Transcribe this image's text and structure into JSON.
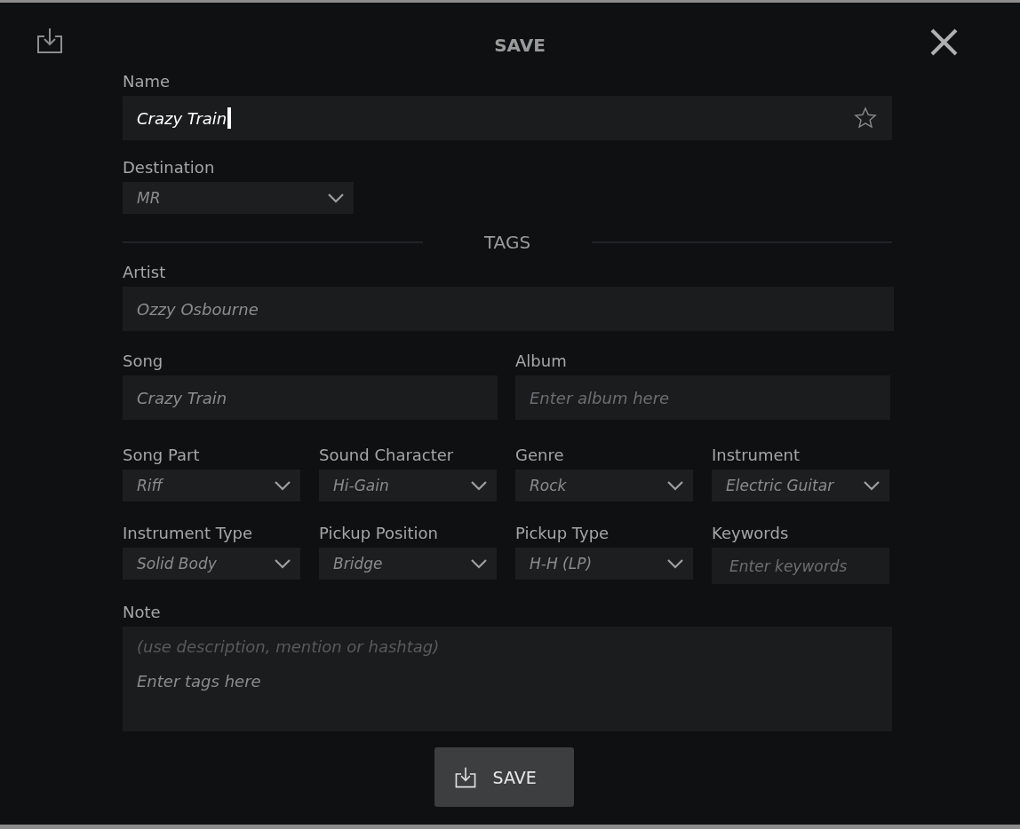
{
  "dialog": {
    "title": "SAVE"
  },
  "name": {
    "label": "Name",
    "value": "Crazy Train",
    "favorite": false
  },
  "destination": {
    "label": "Destination",
    "value": "MR"
  },
  "tags_heading": "TAGS",
  "artist": {
    "label": "Artist",
    "value": "Ozzy Osbourne"
  },
  "song": {
    "label": "Song",
    "value": "Crazy Train"
  },
  "album": {
    "label": "Album",
    "placeholder": "Enter album here"
  },
  "tag_fields": [
    {
      "kind": "select",
      "label": "Song Part",
      "value": "Riff"
    },
    {
      "kind": "select",
      "label": "Sound Character",
      "value": "Hi-Gain"
    },
    {
      "kind": "select",
      "label": "Genre",
      "value": "Rock"
    },
    {
      "kind": "select",
      "label": "Instrument",
      "value": "Electric Guitar"
    },
    {
      "kind": "select",
      "label": "Instrument Type",
      "value": "Solid Body"
    },
    {
      "kind": "select",
      "label": "Pickup Position",
      "value": "Bridge"
    },
    {
      "kind": "select",
      "label": "Pickup Type",
      "value": "H-H (LP)"
    },
    {
      "kind": "input",
      "label": "Keywords",
      "placeholder": "Enter keywords"
    }
  ],
  "note": {
    "label": "Note",
    "hint": "(use description, mention or hashtag)",
    "placeholder": "Enter tags here"
  },
  "save_button": "SAVE"
}
